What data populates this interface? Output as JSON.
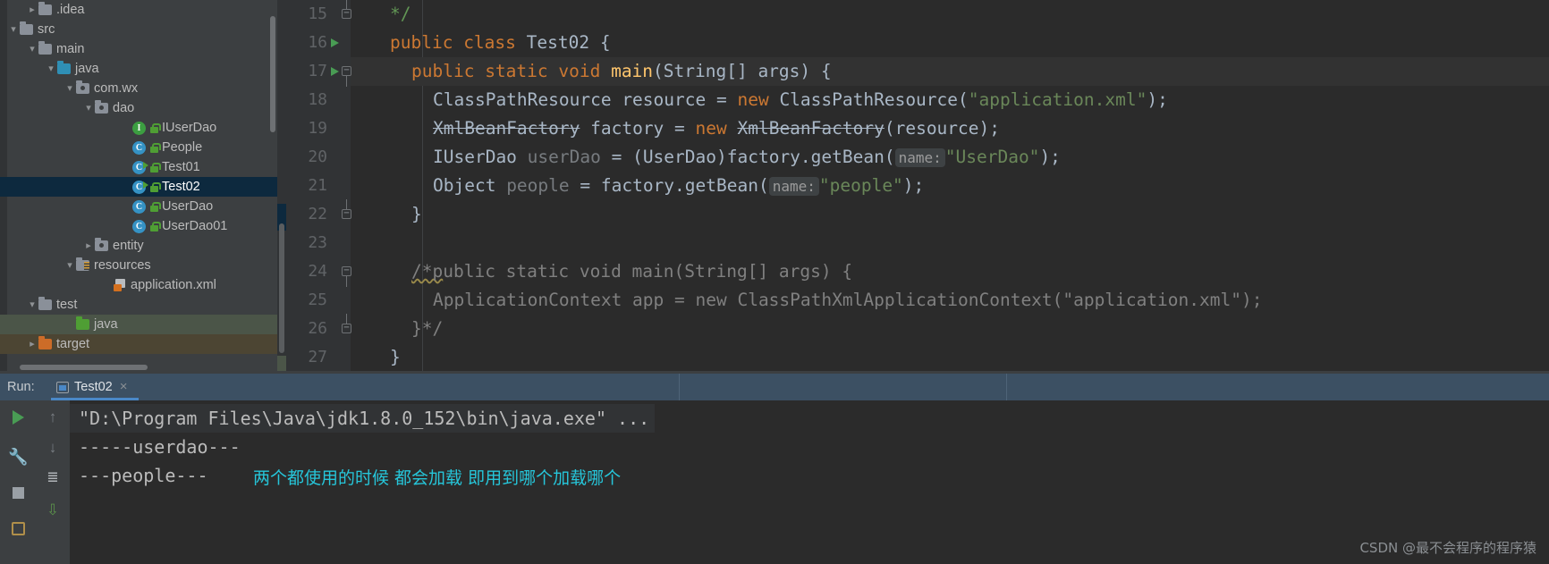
{
  "tree": {
    "rows": [
      {
        "label": ".idea",
        "indent": 2,
        "arrow": "collapsed",
        "icon": "folder-grey",
        "state": "normal"
      },
      {
        "label": "src",
        "indent": 1,
        "arrow": "expanded",
        "icon": "folder-grey",
        "state": "normal"
      },
      {
        "label": "main",
        "indent": 2,
        "arrow": "expanded",
        "icon": "folder-grey",
        "state": "normal"
      },
      {
        "label": "java",
        "indent": 3,
        "arrow": "expanded",
        "icon": "folder-blue",
        "state": "normal"
      },
      {
        "label": "com.wx",
        "indent": 4,
        "arrow": "expanded",
        "icon": "folder-package",
        "state": "normal"
      },
      {
        "label": "dao",
        "indent": 5,
        "arrow": "expanded",
        "icon": "folder-package",
        "state": "normal"
      },
      {
        "label": "IUserDao",
        "indent": 7,
        "arrow": "none",
        "icon": "interface",
        "state": "normal"
      },
      {
        "label": "People",
        "indent": 7,
        "arrow": "none",
        "icon": "class",
        "state": "normal"
      },
      {
        "label": "Test01",
        "indent": 7,
        "arrow": "none",
        "icon": "class-runnable",
        "state": "normal"
      },
      {
        "label": "Test02",
        "indent": 7,
        "arrow": "none",
        "icon": "class-runnable",
        "state": "selected"
      },
      {
        "label": "UserDao",
        "indent": 7,
        "arrow": "none",
        "icon": "class",
        "state": "normal"
      },
      {
        "label": "UserDao01",
        "indent": 7,
        "arrow": "none",
        "icon": "class",
        "state": "normal"
      },
      {
        "label": "entity",
        "indent": 5,
        "arrow": "collapsed",
        "icon": "folder-package",
        "state": "normal"
      },
      {
        "label": "resources",
        "indent": 4,
        "arrow": "expanded",
        "icon": "folder-resources",
        "state": "normal"
      },
      {
        "label": "application.xml",
        "indent": 6,
        "arrow": "none",
        "icon": "xml-file",
        "state": "normal"
      },
      {
        "label": "test",
        "indent": 2,
        "arrow": "expanded",
        "icon": "folder-grey",
        "state": "normal"
      },
      {
        "label": "java",
        "indent": 4,
        "arrow": "none",
        "icon": "folder-green",
        "state": "green-highlight"
      },
      {
        "label": "target",
        "indent": 2,
        "arrow": "collapsed",
        "icon": "folder-orange",
        "state": "olive-highlight"
      }
    ]
  },
  "editor": {
    "lines": [
      {
        "num": "15",
        "gutter_run": false,
        "fold": "end",
        "current": false,
        "tokens": [
          {
            "t": "*/",
            "c": "cm",
            "ind": 1
          }
        ]
      },
      {
        "num": "16",
        "gutter_run": true,
        "fold": "none",
        "current": false,
        "tokens": [
          {
            "t": "public ",
            "c": "k",
            "ind": 1
          },
          {
            "t": "class ",
            "c": "k"
          },
          {
            "t": "Test02 {",
            "c": "id"
          }
        ]
      },
      {
        "num": "17",
        "gutter_run": true,
        "fold": "start",
        "current": true,
        "tokens": [
          {
            "t": "public ",
            "c": "k",
            "ind": 2
          },
          {
            "t": "static ",
            "c": "k"
          },
          {
            "t": "void ",
            "c": "k"
          },
          {
            "t": "main",
            "c": "fn"
          },
          {
            "t": "(String[] args) {",
            "c": "id"
          }
        ]
      },
      {
        "num": "18",
        "gutter_run": false,
        "fold": "none",
        "current": false,
        "tokens": [
          {
            "t": "ClassPathResource resource = ",
            "c": "id",
            "ind": 3
          },
          {
            "t": "new ",
            "c": "k"
          },
          {
            "t": "ClassPathResource(",
            "c": "id"
          },
          {
            "t": "\"application.xml\"",
            "c": "st"
          },
          {
            "t": ");",
            "c": "id"
          }
        ]
      },
      {
        "num": "19",
        "gutter_run": false,
        "fold": "none",
        "current": false,
        "tokens": [
          {
            "t": "XmlBeanFactory",
            "c": "strike",
            "ind": 3
          },
          {
            "t": " factory = ",
            "c": "id"
          },
          {
            "t": "new ",
            "c": "k"
          },
          {
            "t": "XmlBeanFactory",
            "c": "strike"
          },
          {
            "t": "(resource);",
            "c": "id"
          }
        ]
      },
      {
        "num": "20",
        "gutter_run": false,
        "fold": "none",
        "current": false,
        "tokens": [
          {
            "t": "IUserDao ",
            "c": "id",
            "ind": 3
          },
          {
            "t": "userDao",
            "c": "dim"
          },
          {
            "t": " = (UserDao)factory.getBean(",
            "c": "id"
          },
          {
            "t": "name:",
            "c": "hint"
          },
          {
            "t": "\"UserDao\"",
            "c": "st"
          },
          {
            "t": ");",
            "c": "id"
          }
        ]
      },
      {
        "num": "21",
        "gutter_run": false,
        "fold": "none",
        "current": false,
        "tokens": [
          {
            "t": "Object ",
            "c": "id",
            "ind": 3
          },
          {
            "t": "people",
            "c": "dim"
          },
          {
            "t": " = factory.getBean(",
            "c": "id"
          },
          {
            "t": "name:",
            "c": "hint"
          },
          {
            "t": "\"people\"",
            "c": "st"
          },
          {
            "t": ");",
            "c": "id"
          }
        ]
      },
      {
        "num": "22",
        "gutter_run": false,
        "fold": "end",
        "current": false,
        "tokens": [
          {
            "t": "}",
            "c": "id",
            "ind": 2
          }
        ]
      },
      {
        "num": "23",
        "gutter_run": false,
        "fold": "none",
        "current": false,
        "tokens": []
      },
      {
        "num": "24",
        "gutter_run": false,
        "fold": "start",
        "current": false,
        "tokens": [
          {
            "t": "/*p",
            "c": "gc squiggle",
            "ind": 2
          },
          {
            "t": "ublic static void main(String[] args) {",
            "c": "gc"
          }
        ]
      },
      {
        "num": "25",
        "gutter_run": false,
        "fold": "none",
        "current": false,
        "tokens": [
          {
            "t": "ApplicationContext app = new ClassPathXmlApplicationContext(\"application.xml\");",
            "c": "gc",
            "ind": 3
          }
        ]
      },
      {
        "num": "26",
        "gutter_run": false,
        "fold": "end",
        "current": false,
        "tokens": [
          {
            "t": "}*/",
            "c": "gc",
            "ind": 2
          }
        ]
      },
      {
        "num": "27",
        "gutter_run": false,
        "fold": "none",
        "current": false,
        "tokens": [
          {
            "t": "}",
            "c": "id",
            "ind": 1
          }
        ]
      }
    ]
  },
  "run_panel": {
    "label": "Run:",
    "tab_title": "Test02",
    "tab_close": "×",
    "toolbar_icons": [
      "run-icon",
      "scroll-up-icon",
      "wrench-icon",
      "scroll-down-icon",
      "stop-icon",
      "soft-wrap-icon",
      "print-icon",
      "export-icon"
    ],
    "console_lines": [
      "\"D:\\Program Files\\Java\\jdk1.8.0_152\\bin\\java.exe\" ...",
      "-----userdao---",
      "---people---"
    ],
    "annotation": "两个都使用的时候 都会加载 即用到哪个加载哪个",
    "annotation_color": "#26c6da"
  },
  "watermark": "CSDN @最不会程序的程序猿"
}
